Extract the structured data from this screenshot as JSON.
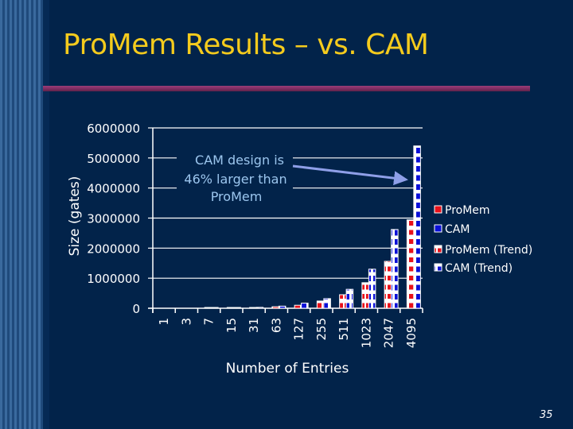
{
  "slide": {
    "title": "ProMem Results – vs. CAM",
    "page_number": "35",
    "colors": {
      "background": "#02234a",
      "title": "#f5cb1d",
      "rule": "#8a3369",
      "promem": "#e8101a",
      "cam": "#0a10d8",
      "annotation": "#9cc6ee",
      "arrow": "#8f9fe8"
    }
  },
  "chart_data": {
    "type": "bar",
    "title": "",
    "xlabel": "Number of Entries",
    "ylabel": "Size (gates)",
    "ylim": [
      0,
      6000000
    ],
    "yticks": [
      0,
      1000000,
      2000000,
      3000000,
      4000000,
      5000000,
      6000000
    ],
    "ytick_labels": [
      "0",
      "1000000",
      "2000000",
      "3000000",
      "4000000",
      "5000000",
      "6000000"
    ],
    "grid": true,
    "legend_position": "right",
    "categories": [
      "1",
      "3",
      "7",
      "15",
      "31",
      "63",
      "127",
      "255",
      "511",
      "1023",
      "2047",
      "4095"
    ],
    "series": [
      {
        "name": "ProMem",
        "values": [
          0,
          0,
          5000,
          10000,
          20000,
          50000,
          100000,
          240000,
          450000,
          850000,
          1560000,
          2940000
        ]
      },
      {
        "name": "CAM",
        "values": [
          0,
          0,
          5000,
          15000,
          30000,
          70000,
          170000,
          320000,
          630000,
          1300000,
          2620000,
          5400000
        ]
      },
      {
        "name": "ProMem (Trend)",
        "values": [
          0,
          0,
          5000,
          10000,
          20000,
          50000,
          100000,
          240000,
          450000,
          850000,
          1560000,
          2940000
        ]
      },
      {
        "name": "CAM (Trend)",
        "values": [
          0,
          0,
          5000,
          15000,
          30000,
          70000,
          170000,
          320000,
          630000,
          1300000,
          2620000,
          5400000
        ]
      }
    ],
    "annotation": {
      "lines": [
        "CAM design is",
        "46% larger than",
        "ProMem"
      ],
      "points_to": "CAM at 4095 entries"
    }
  }
}
